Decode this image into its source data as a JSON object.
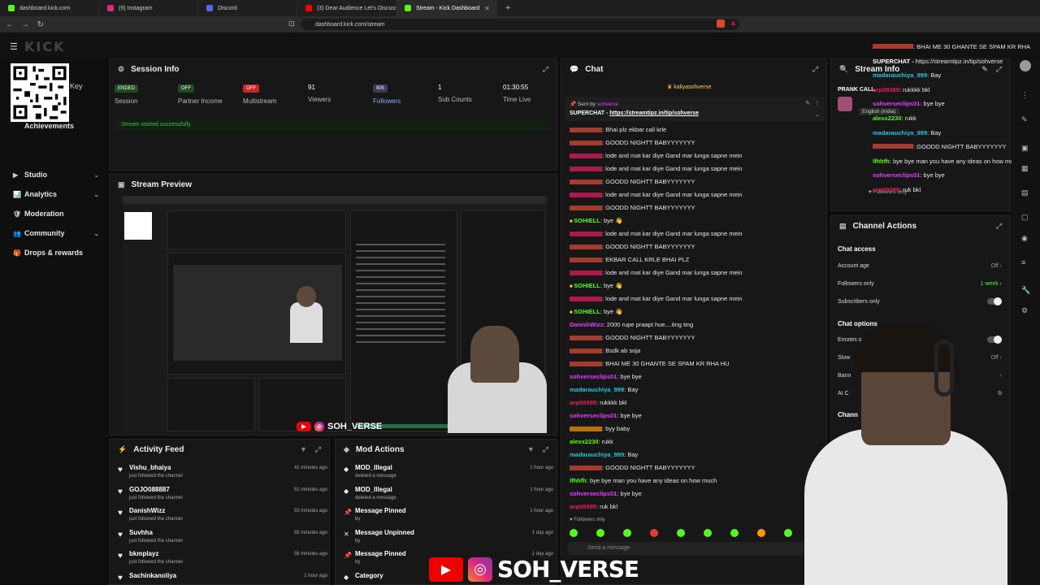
{
  "browser": {
    "tabs": [
      {
        "title": "dashboard.kick.com",
        "color": "#53fc18",
        "active": false
      },
      {
        "title": "(9) Instagram",
        "color": "#dd2a7b",
        "active": false
      },
      {
        "title": "Discord",
        "color": "#5865f2",
        "active": false
      },
      {
        "title": "(3) Dear Audience Let's Discuss ! - Yo",
        "color": "#ff0000",
        "active": false
      },
      {
        "title": "Stream - Kick Dashboard",
        "color": "#53fc18",
        "active": true
      }
    ],
    "url": "dashboard.kick.com/stream"
  },
  "sidebar": {
    "qr_key": "Key",
    "items": [
      {
        "label": "Achievements",
        "chevron": false
      },
      {
        "label": "Studio",
        "chevron": true
      },
      {
        "label": "Analytics",
        "chevron": true
      },
      {
        "label": "Moderation",
        "chevron": false
      },
      {
        "label": "Community",
        "chevron": true
      },
      {
        "label": "Drops & rewards",
        "chevron": false
      }
    ]
  },
  "session_info": {
    "title": "Session Info",
    "stats": [
      {
        "value": "ENDED",
        "label": "Session",
        "badge_color": "#1f4d1f"
      },
      {
        "value": "OFF",
        "label": "Partner Income",
        "badge_color": "#1f4d1f"
      },
      {
        "value": "OFF",
        "label": "Multistream",
        "badge_color": "#c62828"
      },
      {
        "value": "91",
        "label": "Viewers"
      },
      {
        "value": "905",
        "label": "Followers"
      },
      {
        "value": "1",
        "label": "Sub Counts"
      },
      {
        "value": "01:30:55",
        "label": "Time Live"
      }
    ],
    "notice": "Stream started successfully."
  },
  "stream_preview": {
    "title": "Stream Preview",
    "social": "SOH_VERSE"
  },
  "activity_feed": {
    "title": "Activity Feed",
    "items": [
      {
        "name": "Vishu_bhaiya",
        "action": "just followed the channel",
        "time": "41 minutes ago"
      },
      {
        "name": "GOJO088887",
        "action": "just followed the channel",
        "time": "51 minutes ago"
      },
      {
        "name": "DanishWizz",
        "action": "just followed the channel",
        "time": "53 minutes ago"
      },
      {
        "name": "Suvhha",
        "action": "just followed the channel",
        "time": "55 minutes ago"
      },
      {
        "name": "bkmplayz",
        "action": "just followed the channel",
        "time": "56 minutes ago"
      },
      {
        "name": "Sachinkanoliya",
        "action": "",
        "time": "1 hour ago"
      }
    ]
  },
  "mod_actions": {
    "title": "Mod Actions",
    "items": [
      {
        "name": "MOD_Illegal",
        "action": "deleted a message",
        "time": "1 hour ago",
        "icon": "shield"
      },
      {
        "name": "MOD_Illegal",
        "action": "deleted a message",
        "time": "1 hour ago",
        "icon": "shield"
      },
      {
        "name": "Message Pinned",
        "action": "by",
        "time": "1 hour ago",
        "icon": "pin"
      },
      {
        "name": "Message Unpinned",
        "action": "by",
        "time": "1 day ago",
        "icon": "unpin"
      },
      {
        "name": "Message Pinned",
        "action": "by",
        "time": "1 day ago",
        "icon": "pin"
      },
      {
        "name": "Category",
        "action": "",
        "time": "",
        "icon": "shield"
      }
    ]
  },
  "chat": {
    "title": "Chat",
    "pinned_user": "kaliyasohverse",
    "sent_by_label": "Sent by",
    "sent_by_user": "sohverse",
    "superchat_label": "SUPERCHAT -",
    "superchat_link": "https://streamtipz.in/tip/sohverse",
    "messages": [
      {
        "user": "",
        "color": "#e74c3c",
        "text": "Bhai plz ekbar call krle"
      },
      {
        "user": "",
        "color": "#e74c3c",
        "text": "GOODD NIGHTT BABYYYYYYY"
      },
      {
        "user": "",
        "color": "#e91e63",
        "text": "lode and mat kar diye Gand mar lunga sapne mein"
      },
      {
        "user": "",
        "color": "#e91e63",
        "text": "lode and mat kar diye Gand mar lunga sapne mein"
      },
      {
        "user": "",
        "color": "#e74c3c",
        "text": "GOODD NIGHTT BABYYYYYYY"
      },
      {
        "user": "",
        "color": "#e91e63",
        "text": "lode and mat kar diye Gand mar lunga sapne mein"
      },
      {
        "user": "",
        "color": "#e74c3c",
        "text": "GOODD NIGHTT BABYYYYYYY"
      },
      {
        "user": "SOHIELL",
        "color": "#53fc18",
        "text": "bye 👋"
      },
      {
        "user": "",
        "color": "#e91e63",
        "text": "lode and mat kar diye Gand mar lunga sapne mein"
      },
      {
        "user": "",
        "color": "#e74c3c",
        "text": "GOODD NIGHTT BABYYYYYYY"
      },
      {
        "user": "",
        "color": "#e74c3c",
        "text": "EKBAR CALL KRLE BHAI PLZ"
      },
      {
        "user": "",
        "color": "#e91e63",
        "text": "lode and mat kar diye Gand mar lunga sapne mein"
      },
      {
        "user": "SOHIELL",
        "color": "#53fc18",
        "text": "bye 👋"
      },
      {
        "user": "",
        "color": "#e91e63",
        "text": "lode and mat kar diye Gand mar lunga sapne mein"
      },
      {
        "user": "SOHIELL",
        "color": "#53fc18",
        "text": "bye 👋"
      },
      {
        "user": "DanishWizz",
        "color": "#e040fb",
        "text": "2000 rupe praapt hue....ting ting"
      },
      {
        "user": "",
        "color": "#e74c3c",
        "text": "GOODD NIGHTT BABYYYYYYY"
      },
      {
        "user": "",
        "color": "#e74c3c",
        "text": "Bsdk ab soja"
      },
      {
        "user": "",
        "color": "#e74c3c",
        "text": "BHAI ME 30 GHANTE SE SPAM KR RHA HU"
      },
      {
        "user": "sohverseclips01",
        "color": "#e040fb",
        "text": "bye bye"
      },
      {
        "user": "madarauchiya_999",
        "color": "#26c6da",
        "text": "Bay"
      },
      {
        "user": "arpit9389",
        "color": "#e91e63",
        "text": "rukkkk bkl"
      },
      {
        "user": "sohverseclips01",
        "color": "#e040fb",
        "text": "bye bye"
      },
      {
        "user": "",
        "color": "#ff9800",
        "text": "byy baby"
      },
      {
        "user": "alexx2230",
        "color": "#53fc18",
        "text": "rukk"
      },
      {
        "user": "madarauchiya_999",
        "color": "#26c6da",
        "text": "Bay"
      },
      {
        "user": "",
        "color": "#e74c3c",
        "text": "GOODD NIGHTT BABYYYYYYY"
      },
      {
        "user": "lfhhfh",
        "color": "#53fc18",
        "text": "bye bye man you have any ideas on how much"
      },
      {
        "user": "sohverseclips01",
        "color": "#e040fb",
        "text": "bye bye"
      },
      {
        "user": "arpit9389",
        "color": "#e91e63",
        "text": "ruk bkl"
      }
    ],
    "followers_only": "Followers only",
    "input_placeholder": "Send a message"
  },
  "stream_info": {
    "title": "Stream Info",
    "prank_label": "PRANK CALL",
    "overlay_messages": [
      {
        "user": "",
        "color": "#e74c3c",
        "text": "BHAI ME 30 GHANTE SE SPAM KR RHA"
      },
      {
        "user": "SUPERCHAT -",
        "color": "#ffffff",
        "text": "https://streamtipz.in/tip/sohverse"
      },
      {
        "user": "madarauchiya_999",
        "color": "#26c6da",
        "text": "Bay"
      },
      {
        "user": "arpit9389",
        "color": "#e91e63",
        "text": "rukkkk bkl"
      },
      {
        "user": "sohverseclips01",
        "color": "#e040fb",
        "text": "bye bye"
      },
      {
        "user": "alexx2230",
        "color": "#53fc18",
        "text": "rukk"
      },
      {
        "user": "madarauchiya_999",
        "color": "#26c6da",
        "text": "Bay"
      },
      {
        "user": "",
        "color": "#e74c3c",
        "text": "GOODD NIGHTT BABYYYYYYY"
      },
      {
        "user": "lfhhfh",
        "color": "#53fc18",
        "text": "bye bye man you have any ideas on how much"
      },
      {
        "user": "sohverseclips01",
        "color": "#e040fb",
        "text": "bye bye"
      },
      {
        "user": "arpit9389",
        "color": "#e91e63",
        "text": "ruk bkl"
      }
    ],
    "language": "English (India)",
    "followers_only": "Followers only"
  },
  "channel_actions": {
    "title": "Channel Actions",
    "chat_access": "Chat access",
    "account_age": {
      "label": "Account age",
      "value": "Off"
    },
    "followers_only": {
      "label": "Followers only",
      "value": "1 week"
    },
    "subscribers_only": {
      "label": "Subscribers only"
    },
    "chat_options": "Chat options",
    "emotes": "Emotes o",
    "slow": {
      "label": "Slow",
      "value": "Off"
    },
    "banned": "Bann",
    "ai": "AI C",
    "channel": "Chann"
  },
  "bottom_social": "SOH_VERSE"
}
